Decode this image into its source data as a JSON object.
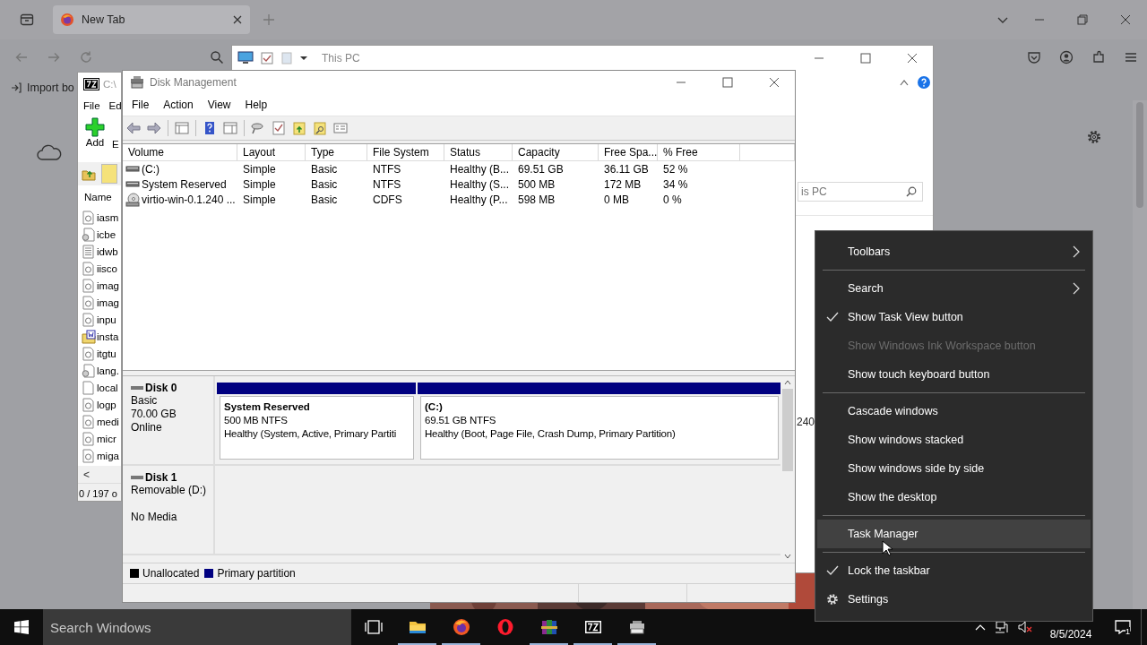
{
  "browser": {
    "tab": {
      "title": "New Tab"
    },
    "bookmark": {
      "label": "Import bo"
    }
  },
  "explorer": {
    "title": "This PC",
    "search": {
      "value": "is PC"
    },
    "cell": "240"
  },
  "sevenzip": {
    "title": "C:\\",
    "menu": [
      "File",
      "Ed"
    ],
    "toolbar": [
      {
        "kind": "add",
        "label": "Add"
      },
      {
        "kind": "extract",
        "label": "E"
      }
    ],
    "column": "Name",
    "files": [
      {
        "name": "iasm",
        "kind": "config"
      },
      {
        "name": "icbe",
        "kind": "dll"
      },
      {
        "name": "idwb",
        "kind": "text"
      },
      {
        "name": "iisco",
        "kind": "config"
      },
      {
        "name": "imag",
        "kind": "config"
      },
      {
        "name": "imag",
        "kind": "config"
      },
      {
        "name": "inpu",
        "kind": "config"
      },
      {
        "name": "insta",
        "kind": "installer"
      },
      {
        "name": "itgtu",
        "kind": "config"
      },
      {
        "name": "lang.",
        "kind": "dll"
      },
      {
        "name": "local",
        "kind": "blank"
      },
      {
        "name": "logp",
        "kind": "config"
      },
      {
        "name": "medi",
        "kind": "config"
      },
      {
        "name": "micr",
        "kind": "config"
      },
      {
        "name": "miga",
        "kind": "config"
      }
    ],
    "scroll_left": "<",
    "status": "0 / 197 o"
  },
  "disk_management": {
    "title": "Disk Management",
    "menu": [
      "File",
      "Action",
      "View",
      "Help"
    ],
    "table": {
      "columns": [
        "Volume",
        "Layout",
        "Type",
        "File System",
        "Status",
        "Capacity",
        "Free Spa...",
        "% Free"
      ],
      "rows": [
        {
          "kind": "drive",
          "cells": [
            "(C:)",
            "Simple",
            "Basic",
            "NTFS",
            "Healthy (B...",
            "69.51 GB",
            "36.11 GB",
            "52 %"
          ]
        },
        {
          "kind": "drive",
          "cells": [
            "System Reserved",
            "Simple",
            "Basic",
            "NTFS",
            "Healthy (S...",
            "500 MB",
            "172 MB",
            "34 %"
          ]
        },
        {
          "kind": "cd",
          "cells": [
            "virtio-win-0.1.240 ...",
            "Simple",
            "Basic",
            "CDFS",
            "Healthy (P...",
            "598 MB",
            "0 MB",
            "0 %"
          ]
        }
      ]
    },
    "disks": [
      {
        "name": "Disk 0",
        "type": "Basic",
        "size": "70.00 GB",
        "status": "Online",
        "partitions": [
          {
            "name": "System Reserved",
            "size": "500 MB NTFS",
            "status": "Healthy (System, Active, Primary Partiti",
            "color": "#000080"
          },
          {
            "name": "(C:)",
            "size": "69.51 GB NTFS",
            "status": "Healthy (Boot, Page File, Crash Dump, Primary Partition)",
            "color": "#000080"
          }
        ]
      },
      {
        "name": "Disk 1",
        "type": "Removable (D:)",
        "status": "No Media"
      }
    ],
    "legend": [
      {
        "label": "Unallocated",
        "color": "#000000"
      },
      {
        "label": "Primary partition",
        "color": "#000080"
      }
    ]
  },
  "context_menu": {
    "groups": [
      [
        {
          "label": "Toolbars",
          "kind": "submenu",
          "checked": false,
          "disabled": false,
          "selected": false
        }
      ],
      [
        {
          "label": "Search",
          "kind": "submenu",
          "checked": false,
          "disabled": false,
          "selected": false
        },
        {
          "label": "Show Task View button",
          "kind": "command",
          "checked": true,
          "disabled": false,
          "selected": false
        },
        {
          "label": "Show Windows Ink Workspace button",
          "kind": "command",
          "checked": false,
          "disabled": true,
          "selected": false
        },
        {
          "label": "Show touch keyboard button",
          "kind": "command",
          "checked": false,
          "disabled": false,
          "selected": false
        }
      ],
      [
        {
          "label": "Cascade windows",
          "kind": "command",
          "checked": false,
          "disabled": false,
          "selected": false
        },
        {
          "label": "Show windows stacked",
          "kind": "command",
          "checked": false,
          "disabled": false,
          "selected": false
        },
        {
          "label": "Show windows side by side",
          "kind": "command",
          "checked": false,
          "disabled": false,
          "selected": false
        },
        {
          "label": "Show the desktop",
          "kind": "command",
          "checked": false,
          "disabled": false,
          "selected": false
        }
      ],
      [
        {
          "label": "Task Manager",
          "kind": "command",
          "checked": false,
          "disabled": false,
          "selected": true
        }
      ],
      [
        {
          "label": "Lock the taskbar",
          "kind": "command",
          "checked": true,
          "disabled": false,
          "selected": false
        },
        {
          "label": "Settings",
          "kind": "settings",
          "checked": false,
          "disabled": false,
          "selected": false
        }
      ]
    ]
  },
  "taskbar": {
    "search": {
      "placeholder": "Search Windows"
    },
    "apps": [
      {
        "kind": "taskview",
        "running": false
      },
      {
        "kind": "explorer",
        "running": true
      },
      {
        "kind": "firefox",
        "running": true
      },
      {
        "kind": "opera",
        "running": false
      },
      {
        "kind": "winrar",
        "running": true
      },
      {
        "kind": "sevenzip",
        "running": true
      },
      {
        "kind": "diskmgmt",
        "running": true
      }
    ],
    "date": "8/5/2024",
    "notifications": "1"
  }
}
